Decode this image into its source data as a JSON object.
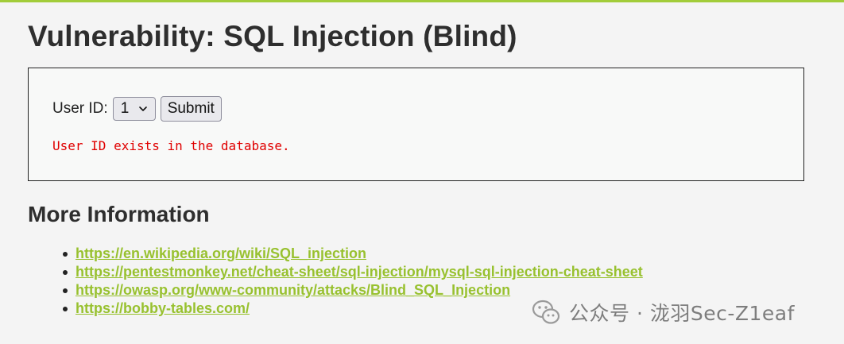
{
  "page": {
    "title": "Vulnerability: SQL Injection (Blind)"
  },
  "form": {
    "user_id_label": "User ID:",
    "selected_user_id": "1",
    "submit_label": "Submit",
    "result_message": "User ID exists in the database."
  },
  "more_info": {
    "heading": "More Information",
    "links": [
      {
        "text": "https://en.wikipedia.org/wiki/SQL_injection"
      },
      {
        "text": "https://pentestmonkey.net/cheat-sheet/sql-injection/mysql-sql-injection-cheat-sheet"
      },
      {
        "text": "https://owasp.org/www-community/attacks/Blind_SQL_Injection"
      },
      {
        "text": "https://bobby-tables.com/"
      }
    ]
  },
  "watermark": {
    "text": "公众号 · 泷羽Sec-Z1eaf",
    "icon": "wechat-icon"
  },
  "colors": {
    "accent_bar": "#a2cc3a",
    "link": "#98c12f",
    "error_text": "#e00000",
    "background": "#f4f4f4"
  }
}
